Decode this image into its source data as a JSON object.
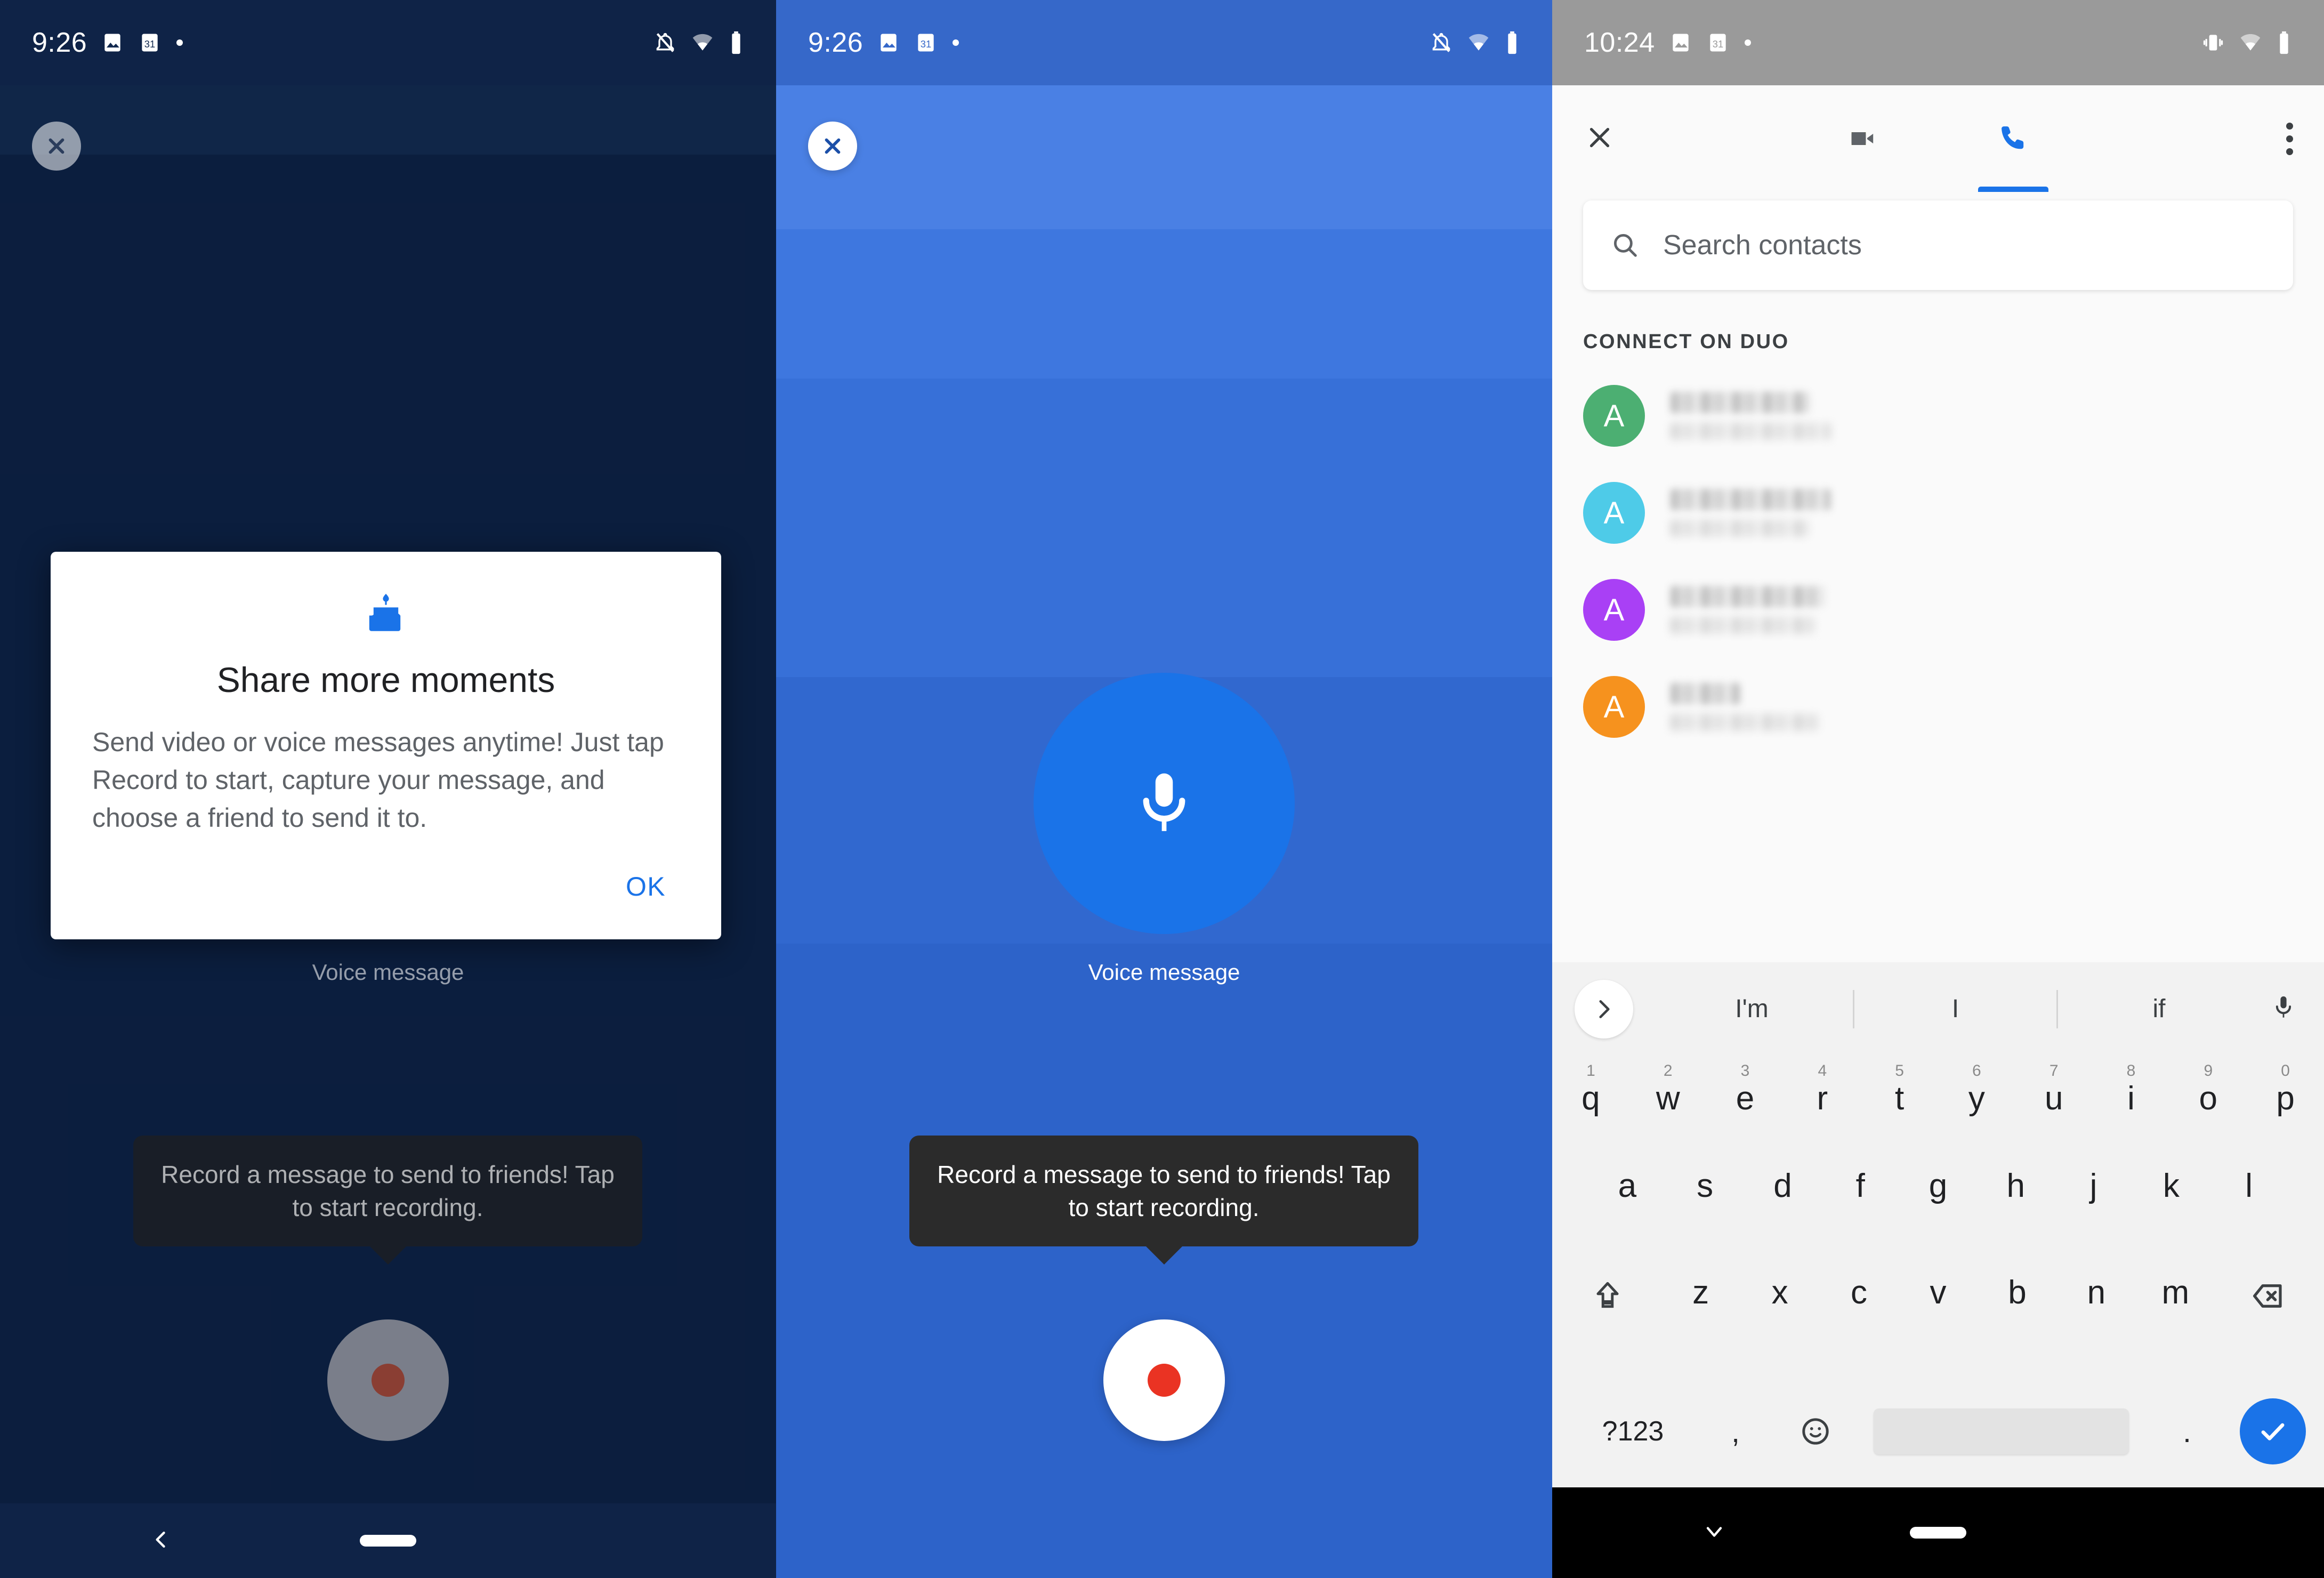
{
  "panel1": {
    "status_bar": {
      "time": "9:26",
      "left_icons": [
        "image-icon",
        "calendar-31-icon",
        "dot-icon"
      ],
      "right_icons": [
        "notifications-off-icon",
        "wifi-icon",
        "battery-icon"
      ]
    },
    "close_button": "close-icon",
    "voice_message_label": "Voice message",
    "tooltip": {
      "text": "Record a message to send to friends! Tap to start recording."
    },
    "record_button": "record-button",
    "dialog": {
      "icon": "birthday-cake-icon",
      "title": "Share more moments",
      "body": "Send video or voice messages anytime! Just tap Record to start, capture your message, and choose a friend to send it to.",
      "ok_label": "OK"
    },
    "nav": {
      "back": "back-chevron-icon",
      "home": "home-pill-icon"
    },
    "colors": {
      "bg": "#12294f",
      "dialog_bg": "#ffffff",
      "accent": "#1a73e8",
      "tooltip_bg": "#2b2b2b"
    }
  },
  "panel2": {
    "status_bar": {
      "time": "9:26",
      "left_icons": [
        "image-icon",
        "calendar-31-icon",
        "dot-icon"
      ],
      "right_icons": [
        "notifications-off-icon",
        "wifi-icon",
        "battery-icon"
      ]
    },
    "close_button": "close-icon",
    "mic_button": "microphone-icon",
    "voice_message_label": "Voice message",
    "tooltip": {
      "text": "Record a message to send to friends! Tap to start recording."
    },
    "record_button": "record-button",
    "colors": {
      "bg": "#3b74de",
      "mic_circle": "#1a73e8",
      "record_dot": "#ea3323",
      "tooltip_bg": "#2b2b2b"
    }
  },
  "panel3": {
    "status_bar": {
      "time": "10:24",
      "left_icons": [
        "image-icon",
        "calendar-31-icon",
        "dot-icon"
      ],
      "right_icons": [
        "vibrate-icon",
        "wifi-icon",
        "battery-icon"
      ]
    },
    "appbar": {
      "close": "close-icon",
      "tabs": [
        {
          "name": "video-call-tab",
          "icon": "video-camera-icon",
          "active": false
        },
        {
          "name": "voice-call-tab",
          "icon": "phone-icon",
          "active": true
        }
      ],
      "overflow": "more-vert-icon"
    },
    "search": {
      "icon": "search-icon",
      "placeholder": "Search contacts",
      "value": ""
    },
    "section_header": "CONNECT ON DUO",
    "contacts": [
      {
        "initial": "A",
        "color": "#4caf72",
        "name_redacted": true,
        "subtitle_redacted": true,
        "name_w": 260,
        "sub_w": 300
      },
      {
        "initial": "A",
        "color": "#4ecbe8",
        "name_redacted": true,
        "subtitle_redacted": true,
        "name_w": 300,
        "sub_w": 260
      },
      {
        "initial": "A",
        "color": "#a githubd42ff",
        "name_redacted": true,
        "subtitle_redacted": true,
        "name_w": 290,
        "sub_w": 270
      },
      {
        "initial": "A",
        "color": "#f6921e",
        "name_redacted": true,
        "subtitle_redacted": true,
        "name_w": 130,
        "sub_w": 280
      }
    ],
    "keyboard": {
      "expand_icon": "chevron-right-icon",
      "mic_icon": "microphone-icon",
      "suggestions": [
        "I'm",
        "I",
        "if"
      ],
      "row1": [
        {
          "letter": "q",
          "num": "1"
        },
        {
          "letter": "w",
          "num": "2"
        },
        {
          "letter": "e",
          "num": "3"
        },
        {
          "letter": "r",
          "num": "4"
        },
        {
          "letter": "t",
          "num": "5"
        },
        {
          "letter": "y",
          "num": "6"
        },
        {
          "letter": "u",
          "num": "7"
        },
        {
          "letter": "i",
          "num": "8"
        },
        {
          "letter": "o",
          "num": "9"
        },
        {
          "letter": "p",
          "num": "0"
        }
      ],
      "row2": [
        "a",
        "s",
        "d",
        "f",
        "g",
        "h",
        "j",
        "k",
        "l"
      ],
      "row3": [
        "z",
        "x",
        "c",
        "v",
        "b",
        "n",
        "m"
      ],
      "shift_icon": "shift-icon",
      "backspace_icon": "backspace-icon",
      "numeric_label": "?123",
      "comma": ",",
      "period": ".",
      "emoji_icon": "emoji-icon",
      "enter_icon": "check-icon"
    },
    "nav": {
      "down": "chevron-down-icon",
      "home": "home-pill-icon"
    },
    "colors": {
      "bg": "#fafafa",
      "accent": "#1a73e8",
      "keyboard_bg": "#f2f2f2",
      "statusbar": "#9a9a9a"
    }
  }
}
